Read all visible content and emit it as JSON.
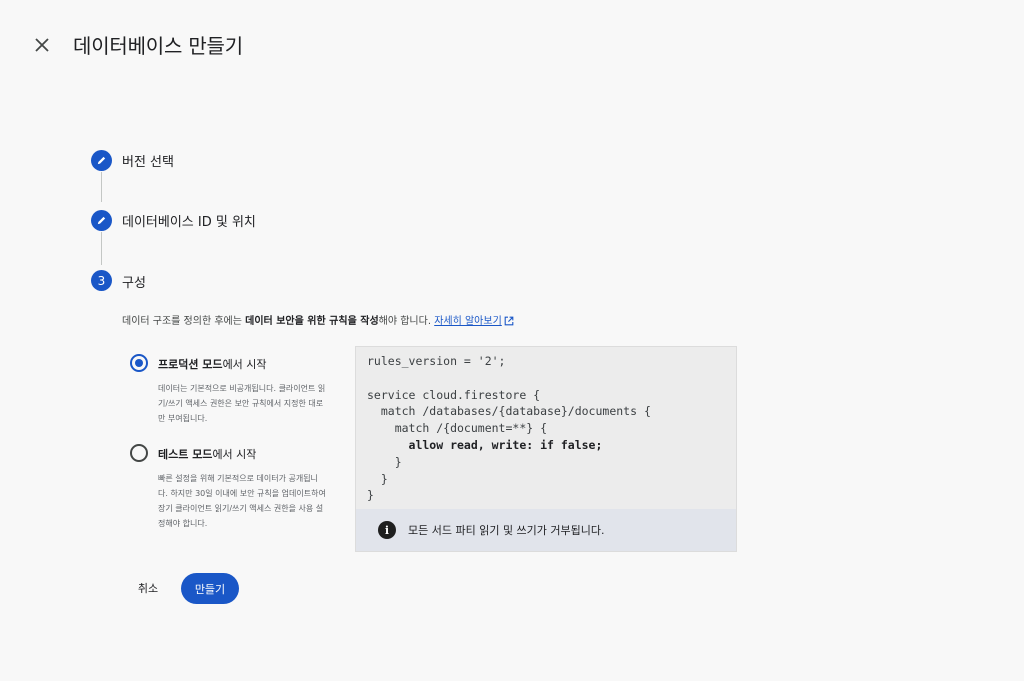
{
  "header": {
    "close_icon": "close-icon",
    "title": "데이터베이스 만들기"
  },
  "steps": [
    {
      "label": "버전 선택",
      "icon": "pencil-icon",
      "state": "completed"
    },
    {
      "label": "데이터베이스 ID 및 위치",
      "icon": "pencil-icon",
      "state": "completed"
    },
    {
      "label": "구성",
      "number": "3",
      "state": "active"
    }
  ],
  "config": {
    "intro_pre": "데이터 구조를 정의한 후에는 ",
    "intro_bold": "데이터 보안을 위한 규칙을 작성",
    "intro_post": "해야 합니다. ",
    "learn_more": "자세히 알아보기",
    "options": [
      {
        "title_bold": "프로덕션 모드",
        "title_rest": "에서 시작",
        "selected": true,
        "desc": "데이터는 기본적으로 비공개됩니다. 클라이언트 읽기/쓰기 액세스 권한은 보안 규칙에서 지정한 대로만 부여됩니다."
      },
      {
        "title_bold": "테스트 모드",
        "title_rest": "에서 시작",
        "selected": false,
        "desc": "빠른 설정을 위해 기본적으로 데이터가 공개됩니다. 하지만 30일 이내에 보안 규칙을 업데이트하여 장기 클라이언트 읽기/쓰기 액세스 권한을 사용 설정해야 합니다."
      }
    ],
    "code_lines": [
      "rules_version = '2';",
      "",
      "service cloud.firestore {",
      "  match /databases/{database}/documents {",
      "    match /{document=**} {",
      "      allow read, write: if false;",
      "    }",
      "  }",
      "}"
    ],
    "notice": "모든 서드 파티 읽기 및 쓰기가 거부됩니다."
  },
  "actions": {
    "cancel": "취소",
    "create": "만들기"
  },
  "colors": {
    "accent": "#1a57c7",
    "background": "#f8f8f8",
    "code_bg": "#ececec",
    "notice_bg": "#e1e4eb"
  }
}
